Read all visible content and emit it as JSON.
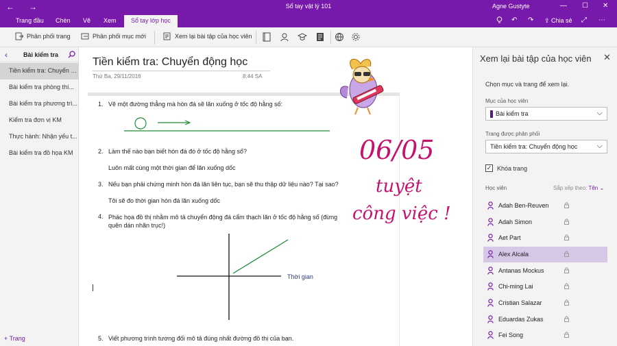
{
  "titlebar": {
    "doc_title": "Sổ tay vật lý 101",
    "user": "Agne Gustyte",
    "back_icon": "←",
    "forward_icon": "→"
  },
  "tabs": [
    {
      "label": "Trang đầu"
    },
    {
      "label": "Chèn"
    },
    {
      "label": "Vẽ"
    },
    {
      "label": "Xem"
    },
    {
      "label": "Sổ tay lớp học"
    }
  ],
  "share_label": "Chia sẻ",
  "ribbon": {
    "distribute_page": "Phân phối trang",
    "distribute_section": "Phân phối mục mới",
    "review_work": "Xem lại bài tập của học viên"
  },
  "section": {
    "name": "Bài kiểm tra"
  },
  "pages": [
    "Tiền kiểm tra: Chuyển đ...",
    "Bài kiểm tra phòng thí...",
    "Bài kiểm tra phương trì...",
    "Kiểm tra đơn vị KM",
    "Thực hành: Nhận yếu t...",
    "Bài kiểm tra đồ họa KM"
  ],
  "add_page": "+ Trang",
  "note": {
    "title": "Tiền kiểm tra: Chuyển động học",
    "date": "Thứ Ba, 29/11/2016",
    "time": "8:44 SA",
    "q1": "Vẽ một đường thẳng mà hòn đá sẽ lăn xuống ở tốc độ hằng số:",
    "q2": "Làm thế nào bạn biết hòn đá đó ở tốc độ hằng số?",
    "a2": "Luôn mất cùng một thời gian để lăn xuống dốc",
    "q3": "Nếu bạn phải chứng minh hòn đá lăn liên tục, bạn sẽ thu thập dữ liệu nào? Tại sao?",
    "a3": "Tôi sẽ đo thời gian hòn đá lăn xuống dốc",
    "q4": "Phác họa đồ thị nhằm mô tả chuyển động đá cẩm thạch lăn ở tốc độ hằng số (đừng quên dán nhãn trục!)",
    "axis_label": "Thời gian",
    "q5": "Viết phương trình tương đối mô tả đúng nhất đường đồ thị của bạn.",
    "nums": [
      "1.",
      "2.",
      "3.",
      "4.",
      "5."
    ],
    "grade": "06/05",
    "comment1": "tuyệt",
    "comment2": "công việc !"
  },
  "review": {
    "title": "Xem lại bài tập của học viên",
    "instruction": "Chọn mục và trang để xem lại.",
    "section_label": "Mục của học viên",
    "section_value": "Bài kiểm tra",
    "page_label": "Trang được phân phối",
    "page_value": "Tiền kiểm tra: Chuyển động học",
    "lock_label": "Khóa trang",
    "students_label": "Học viên",
    "sort_label": "Sắp xếp theo:",
    "sort_value": "Tên",
    "students": [
      "Adah Ben-Reuven",
      "Adah Simon",
      "Aet Part",
      "Alex Alcala",
      "Antanas Mockus",
      "Chi-ming Lai",
      "Cristian Salazar",
      "Eduardas Zukas",
      "Fei Song"
    ]
  },
  "colors": {
    "accent": "#7719aa",
    "ink_green": "#1e8a3a",
    "ink_pink": "#c4136f",
    "answer_green": "#22a33a"
  }
}
